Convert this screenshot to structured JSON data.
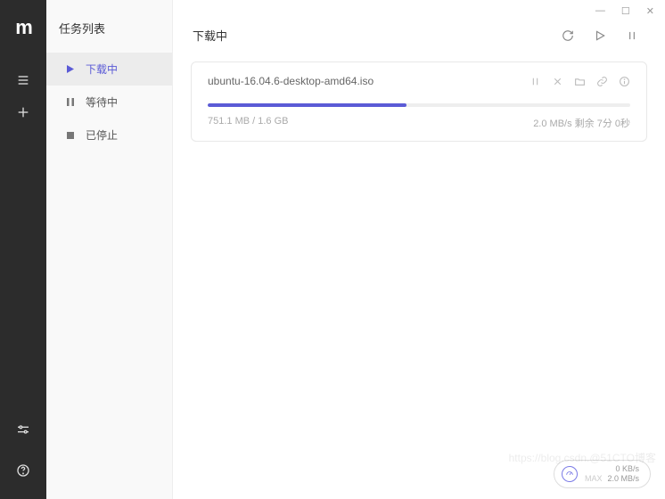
{
  "sidebar": {
    "title": "任务列表",
    "items": [
      {
        "label": "下载中"
      },
      {
        "label": "等待中"
      },
      {
        "label": "已停止"
      }
    ]
  },
  "header": {
    "title": "下载中"
  },
  "task": {
    "name": "ubuntu-16.04.6-desktop-amd64.iso",
    "progress_percent": 47,
    "size_label": "751.1 MB / 1.6 GB",
    "speed_eta": "2.0 MB/s 剩余 7分 0秒"
  },
  "speed_widget": {
    "top": "0 KB/s",
    "max_label": "MAX",
    "bottom": "2.0 MB/s"
  },
  "watermark": "https://blog.csdn.@51CTO博客"
}
